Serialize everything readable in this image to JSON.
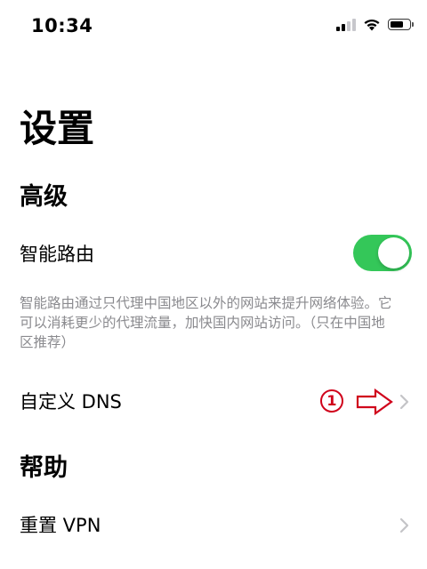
{
  "status_bar": {
    "time": "10:34",
    "icons": [
      "cellular-signal-icon",
      "wifi-icon",
      "battery-icon"
    ]
  },
  "page": {
    "title": "设置"
  },
  "sections": {
    "advanced": {
      "title": "高级",
      "smart_routing": {
        "label": "智能路由",
        "enabled": true,
        "description": "智能路由通过只代理中国地区以外的网站来提升网络体验。它可以消耗更少的代理流量，加快国内网站访问。（只在中国地区推荐）"
      },
      "custom_dns": {
        "label": "自定义 DNS",
        "annotation_number": "①"
      }
    },
    "help": {
      "title": "帮助",
      "reset_vpn": {
        "label": "重置 VPN"
      }
    }
  },
  "colors": {
    "toggle_on": "#34c759",
    "annotation_red": "#d0021b",
    "secondary_text": "#8a8a8e",
    "chevron": "#c4c4c7"
  }
}
